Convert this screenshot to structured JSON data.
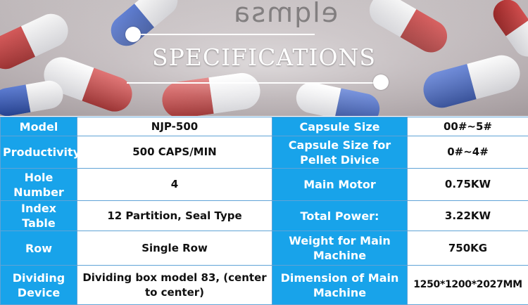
{
  "banner": {
    "title": "SPECIFICATIONS",
    "background_text": "elqmsa"
  },
  "specs": {
    "rows": [
      {
        "label1": "Model",
        "value1": "NJP-500",
        "label2": "Capsule Size",
        "value2": "00#~5#"
      },
      {
        "label1": "Productivity",
        "value1": "500 CAPS/MIN",
        "label2": "Capsule Size for Pellet Divice",
        "value2": "0#~4#"
      },
      {
        "label1": "Hole Number",
        "value1": "4",
        "label2": "Main Motor",
        "value2": "0.75KW"
      },
      {
        "label1": "Index Table",
        "value1": "12 Partition, Seal Type",
        "label2": "Total Power:",
        "value2": "3.22KW"
      },
      {
        "label1": "Row",
        "value1": "Single Row",
        "label2": "Weight for Main Machine",
        "value2": "750KG"
      },
      {
        "label1": "Dividing Device",
        "value1": "Dividing box model 83, (center to center)",
        "label2": "Dimension of Main Machine",
        "value2": "1250*1200*2027MM"
      }
    ]
  },
  "colors": {
    "label_bg": "#18a3ea",
    "border": "#5fa3d6",
    "title": "#ffffff"
  }
}
